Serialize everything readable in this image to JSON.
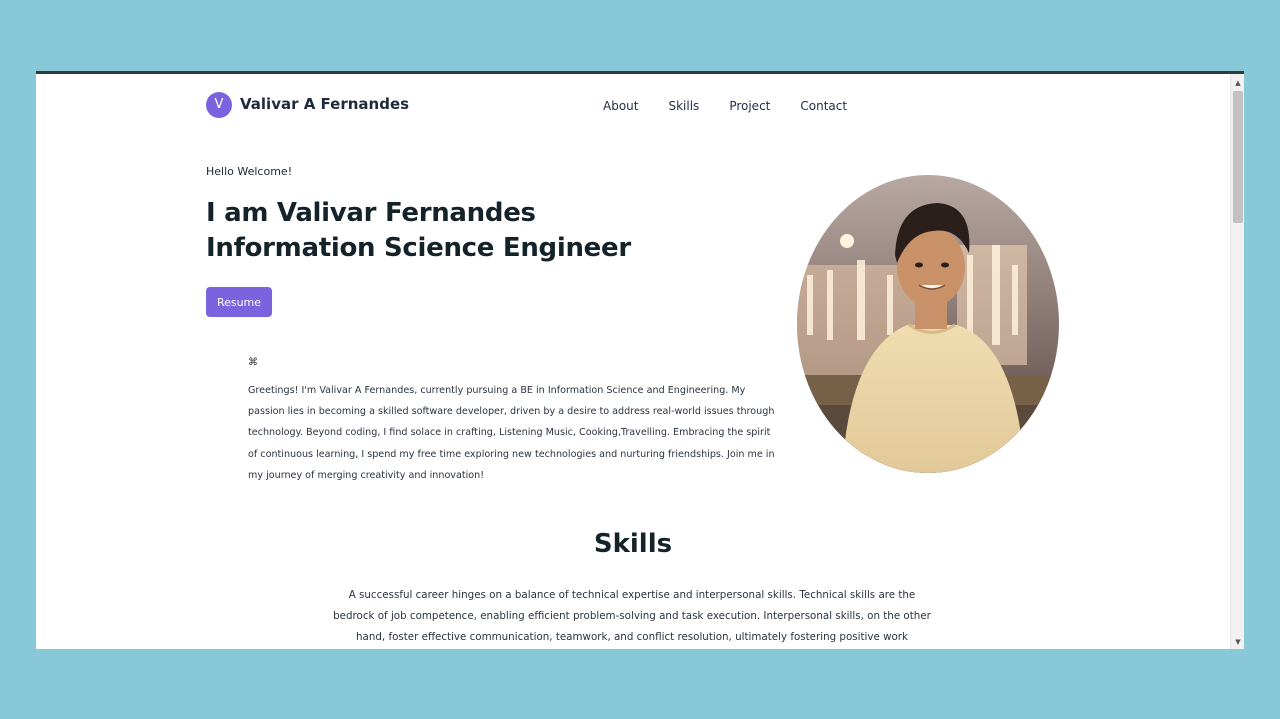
{
  "nav": {
    "logo_letter": "V",
    "brand": "Valivar A Fernandes",
    "links": [
      "About",
      "Skills",
      "Project",
      "Contact"
    ]
  },
  "hero": {
    "greeting": "Hello Welcome!",
    "title_line1": "I am Valivar Fernandes",
    "title_line2": "Information Science Engineer",
    "resume_label": "Resume",
    "portrait_icon": "profile-photo"
  },
  "about": {
    "icon": "⌘",
    "text": "Greetings! I'm Valivar A Fernandes, currently pursuing a BE in Information Science and Engineering. My passion lies in becoming a skilled software developer, driven by a desire to address real-world issues through technology. Beyond coding, I find solace in crafting, Listening Music, Cooking,Travelling. Embracing the spirit of continuous learning, I spend my free time exploring new technologies and nurturing friendships. Join me in my journey of merging creativity and innovation!"
  },
  "skills": {
    "title": "Skills",
    "text": "A successful career hinges on a balance of technical expertise and interpersonal skills. Technical skills are the bedrock of job competence, enabling efficient problem-solving and task execution. Interpersonal skills, on the other hand, foster effective communication, teamwork, and conflict resolution, ultimately fostering positive work"
  },
  "colors": {
    "accent": "#7b63e0",
    "page_background": "#89c8d8",
    "heading": "#14222a"
  }
}
